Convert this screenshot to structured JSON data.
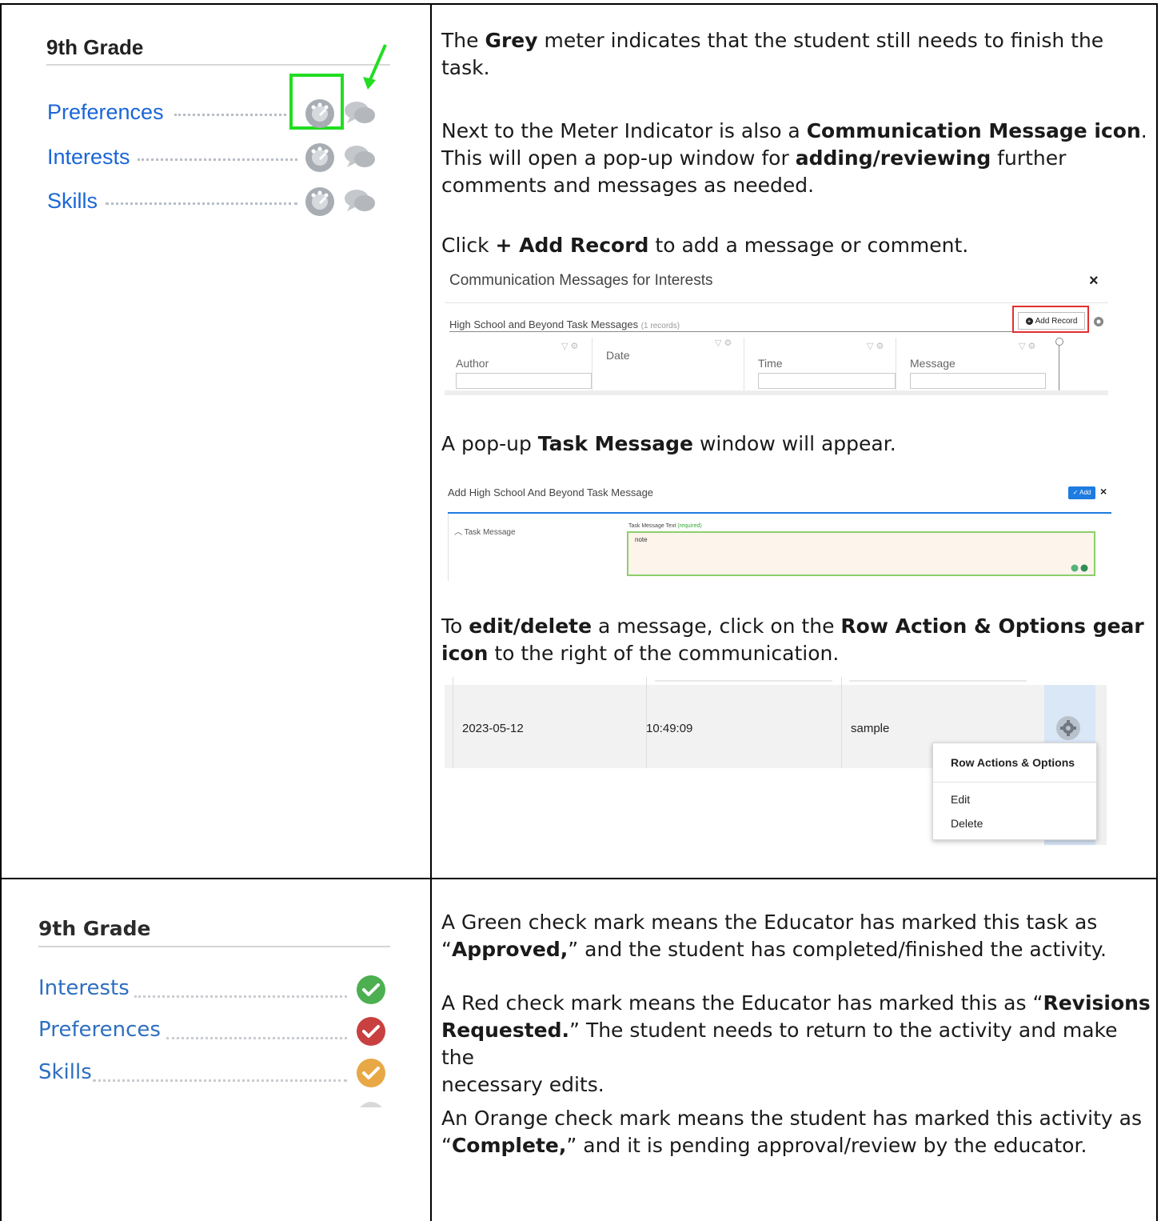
{
  "row1": {
    "left": {
      "grade_title": "9th Grade",
      "tasks": [
        "Preferences",
        "Interests",
        "Skills"
      ]
    },
    "right": {
      "p1_pre": "The ",
      "p1_bold": "Grey",
      "p1_line1_post": " meter indicates that the student still needs to finish the",
      "p1_line2": "task.",
      "p2_line1_pre": "Next to the Meter Indicator is also a ",
      "p2_line1_bold": "Communication Message icon",
      "p2_line1_post": ".",
      "p2_line2_pre": "This will open a pop-up window for ",
      "p2_line2_bold": "adding/reviewing",
      "p2_line2_post": " further",
      "p2_line3": "comments and messages as needed.",
      "p3_pre": "Click ",
      "p3_bold": "+ Add Record",
      "p3_post": " to add a message or comment.",
      "comm_window": {
        "title": "Communication Messages for Interests",
        "close": "×",
        "section_title": "High School and Beyond Task Messages",
        "record_count": "(1 records)",
        "add_record": "Add Record",
        "columns": [
          "Author",
          "Date",
          "Time",
          "Message"
        ]
      },
      "p4_pre": "A pop-up ",
      "p4_bold": "Task Message",
      "p4_post": " window will appear.",
      "task_window": {
        "title": "Add High School And Beyond Task Message",
        "add_button": "✓ Add",
        "close": "×",
        "section": "Task Message",
        "field_label": "Task Message Text",
        "field_required": "(required)",
        "field_value": "note"
      },
      "p5_line1_pre": "To ",
      "p5_line1_bold1": "edit/delete",
      "p5_line1_mid": " a message, click on the ",
      "p5_line1_bold2": "Row Action & Options gear",
      "p5_line2_bold": "icon",
      "p5_line2_post": " to the right of the communication.",
      "row_window": {
        "date": "2023-05-12",
        "time": "10:49:09",
        "message": "sample",
        "menu_title": "Row Actions & Options",
        "menu_items": [
          "Edit",
          "Delete"
        ]
      }
    }
  },
  "row2": {
    "left": {
      "grade_title": "9th Grade",
      "tasks": [
        "Interests",
        "Preferences",
        "Skills"
      ]
    },
    "right": {
      "p1_line1": "A Green check mark means the Educator has marked this task as",
      "p1_line2_pre": "“",
      "p1_line2_bold": "Approved,",
      "p1_line2_post": "” and the student has completed/finished the activity.",
      "p2_line1_pre": "A Red check mark means the Educator has marked this as “",
      "p2_line1_bold": "Revisions",
      "p2_line2_bold": "Requested.",
      "p2_line2_post": "” The student needs to return to the activity and make the",
      "p2_line3": "necessary edits.",
      "p3_line1": "An Orange check mark means the student has marked this activity as",
      "p3_line2_pre": "“",
      "p3_line2_bold": "Complete,",
      "p3_line2_post": "” and it is pending approval/review by the educator."
    }
  },
  "colors": {
    "link_blue": "#1a66d6",
    "highlight_green": "#22dd22",
    "add_record_border": "#e03030",
    "approved_green": "#4caf50",
    "revisions_red": "#c94040",
    "complete_orange": "#e8a845",
    "primary_button": "#1e7be0"
  },
  "icons": [
    "meter-icon",
    "chat-bubble-icon",
    "gear-icon",
    "filter-icon",
    "check-circle-icon",
    "plus-circle-icon",
    "close-icon",
    "chevron-up-icon"
  ]
}
